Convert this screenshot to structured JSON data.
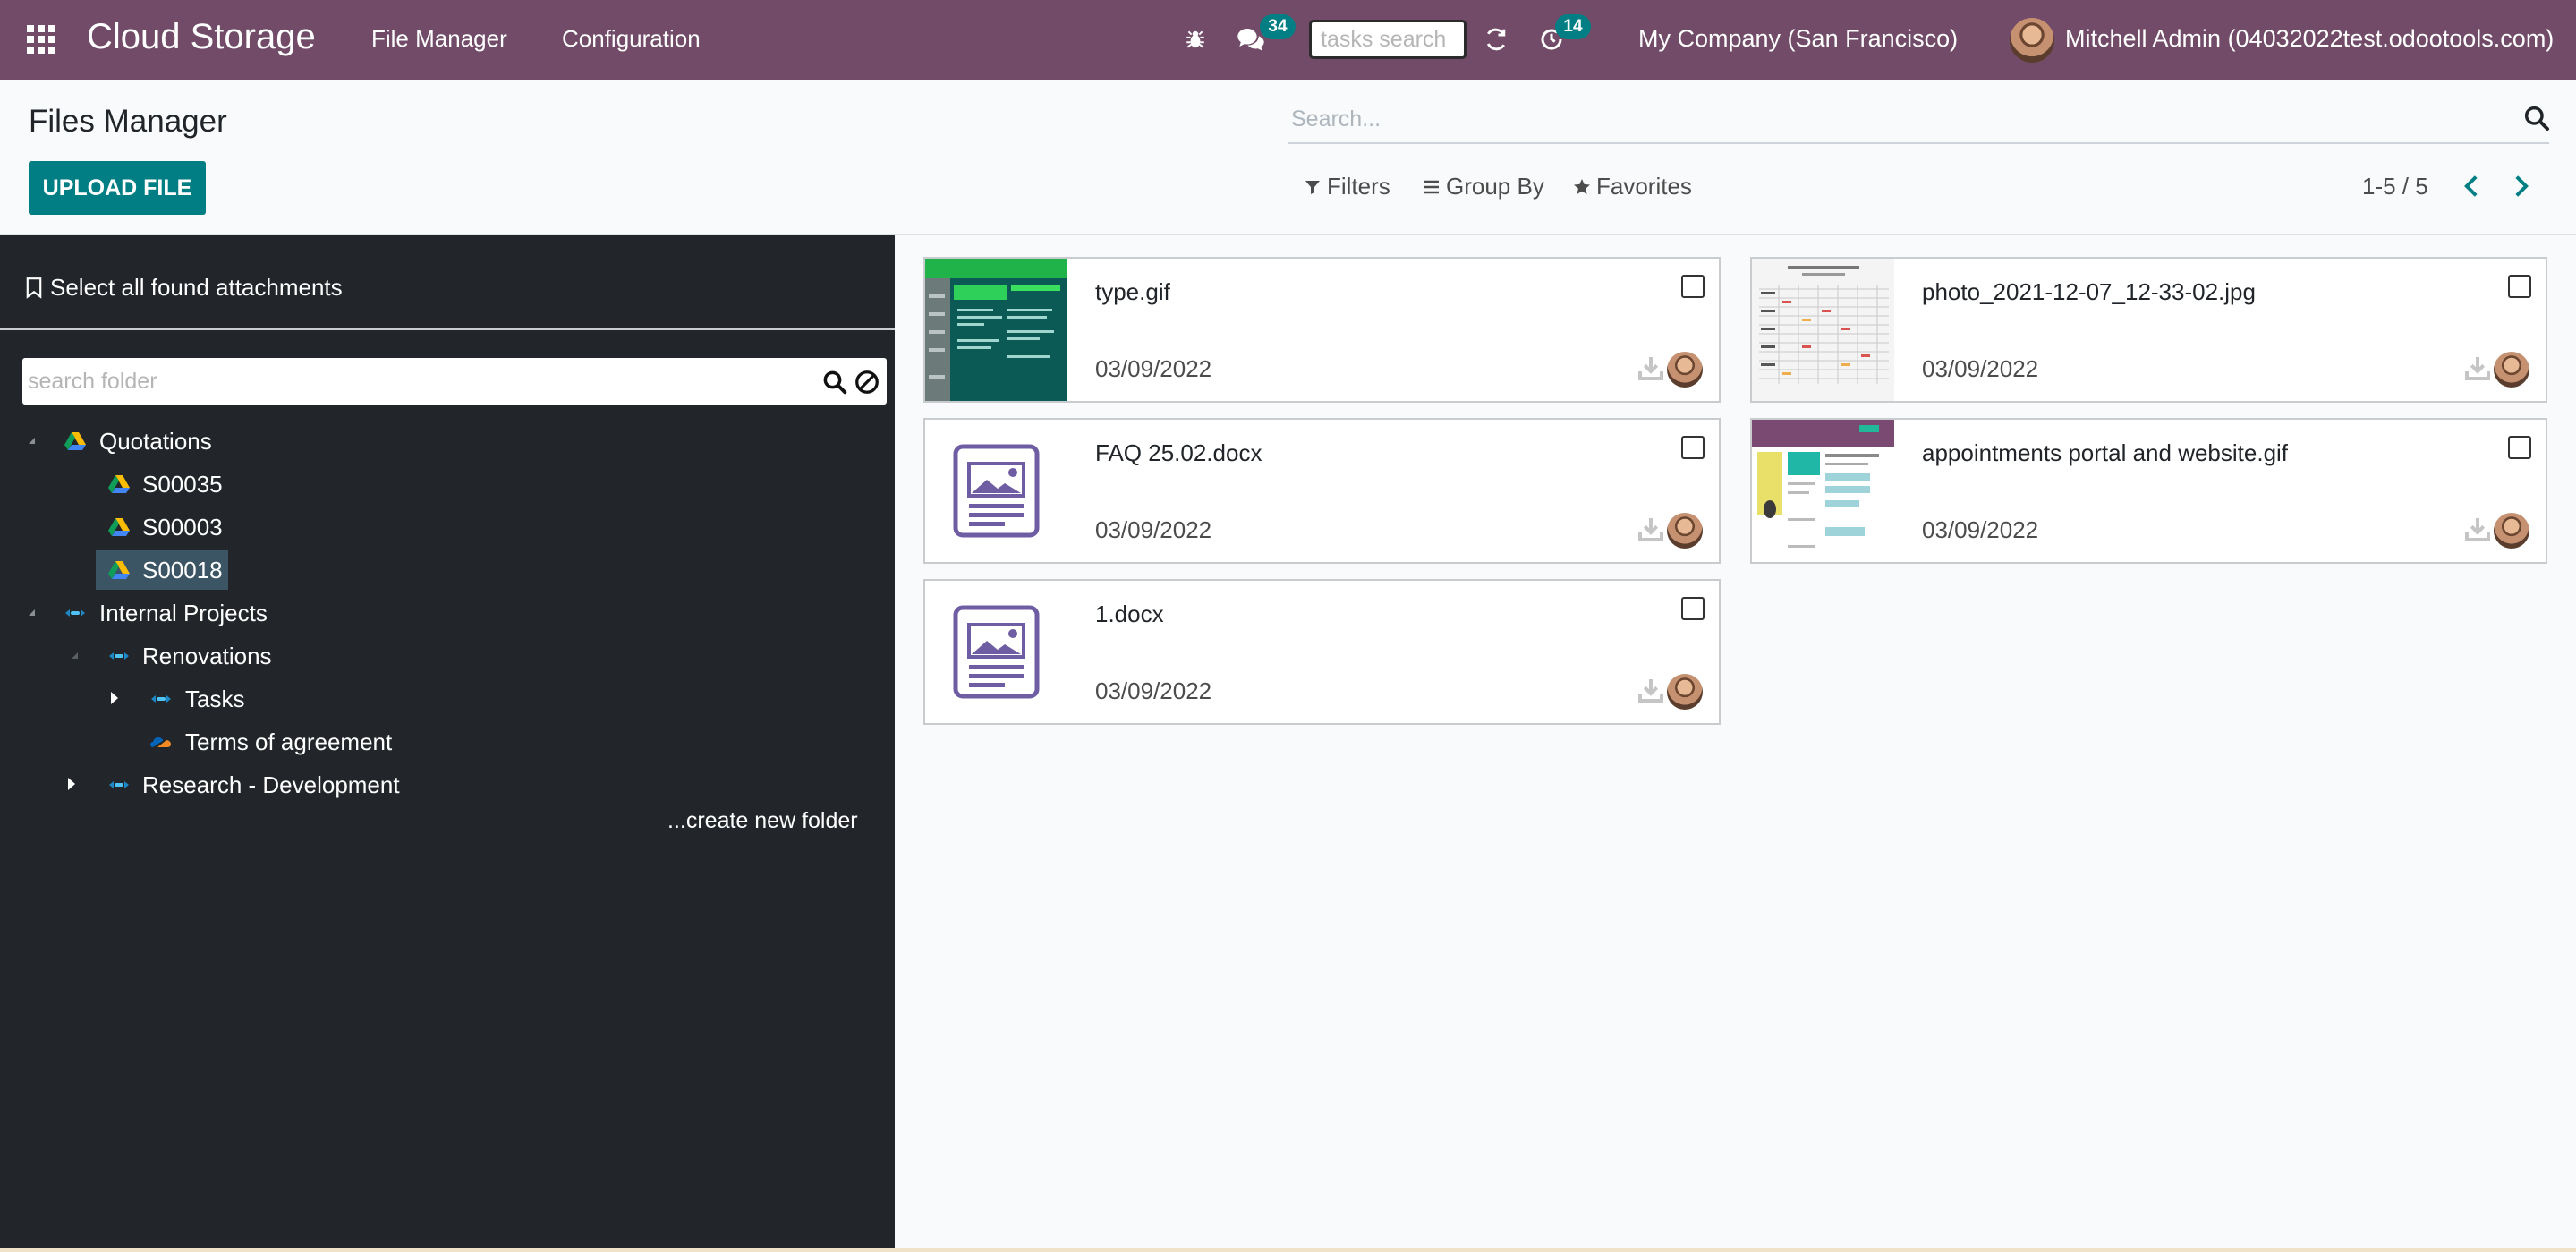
{
  "navbar": {
    "app_title": "Cloud Storage",
    "menu": [
      "File Manager",
      "Configuration"
    ],
    "messages_count": "34",
    "tasks_search_placeholder": "tasks search",
    "activities_count": "14",
    "company": "My Company (San Francisco)",
    "user": "Mitchell Admin (04032022test.odootools.com)",
    "accent_color": "#714b67"
  },
  "control_panel": {
    "title": "Files Manager",
    "upload_label": "UPLOAD FILE",
    "search_placeholder": "Search...",
    "filters_label": "Filters",
    "group_by_label": "Group By",
    "favorites_label": "Favorites",
    "pager": "1-5 / 5",
    "primary_color": "#017e84"
  },
  "sidebar": {
    "select_all_label": "Select all found attachments",
    "folder_search_placeholder": "search folder",
    "tree": [
      {
        "label": "Quotations",
        "icon": "google-drive-icon"
      },
      {
        "label": "S00035",
        "icon": "google-drive-icon"
      },
      {
        "label": "S00003",
        "icon": "google-drive-icon"
      },
      {
        "label": "S00018",
        "icon": "google-drive-icon",
        "selected": true
      },
      {
        "label": "Internal Projects",
        "icon": "cloud-sync-icon"
      },
      {
        "label": "Renovations",
        "icon": "cloud-sync-icon"
      },
      {
        "label": "Tasks",
        "icon": "cloud-sync-icon"
      },
      {
        "label": "Terms of agreement",
        "icon": "onedrive-icon"
      },
      {
        "label": "Research - Development",
        "icon": "cloud-sync-icon"
      }
    ],
    "create_folder_label": "...create new folder"
  },
  "files": [
    {
      "name": "type.gif",
      "date": "03/09/2022",
      "thumb": "screenshot-green"
    },
    {
      "name": "photo_2021-12-07_12-33-02.jpg",
      "date": "03/09/2022",
      "thumb": "table-document"
    },
    {
      "name": "FAQ 25.02.docx",
      "date": "03/09/2022",
      "thumb": "generic-document-icon"
    },
    {
      "name": "appointments portal and website.gif",
      "date": "03/09/2022",
      "thumb": "screenshot-purple"
    },
    {
      "name": "1.docx",
      "date": "03/09/2022",
      "thumb": "generic-document-icon"
    }
  ]
}
